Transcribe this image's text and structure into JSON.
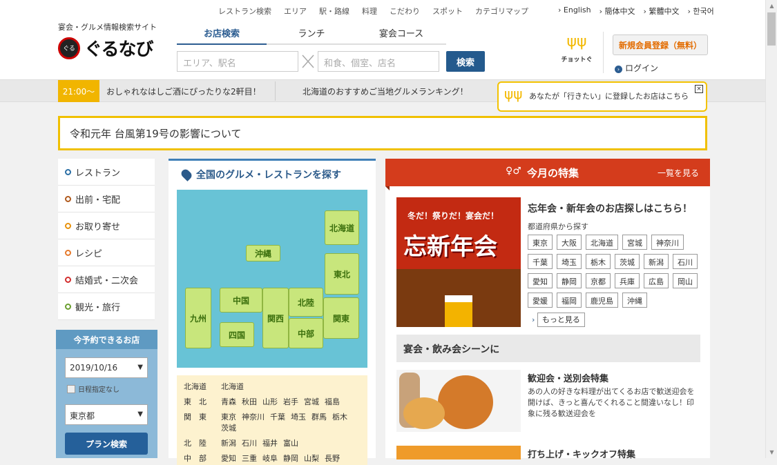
{
  "topnav": [
    "レストラン検索",
    "エリア",
    "駅・路線",
    "料理",
    "こだわり",
    "スポット",
    "カテゴリマップ"
  ],
  "languages": [
    "English",
    "簡体中文",
    "繁體中文",
    "한국어"
  ],
  "logo": {
    "tagline": "宴会・グルメ情報検索サイト",
    "name": "ぐるなび",
    "emblem": "ぐる"
  },
  "search_tabs": [
    "お店検索",
    "ランチ",
    "宴会コース"
  ],
  "search": {
    "area_placeholder": "エリア、駅名",
    "keyword_placeholder": "和食、個室、店名",
    "button": "検索"
  },
  "chotto": {
    "label": "チョットぐ",
    "icon": "fork-icon"
  },
  "register_button": "新規会員登録（無料）",
  "login": "ログイン",
  "ticker": {
    "time": "21:00〜",
    "item1": "おしゃれなはしご酒にぴったりな2軒目！",
    "item2": "北海道のおすすめご当地グルメランキング！"
  },
  "popup": {
    "text": "あなたが「行きたい」に登録したお店はこちら",
    "close": "×"
  },
  "notice": "令和元年 台風第19号の影響について",
  "left_menu": [
    {
      "label": "レストラン",
      "color": "#2b6fa5"
    },
    {
      "label": "出前・宅配",
      "color": "#b05a1d"
    },
    {
      "label": "お取り寄せ",
      "color": "#e8920c"
    },
    {
      "label": "レシピ",
      "color": "#e67a2c"
    },
    {
      "label": "結婚式・二次会",
      "color": "#d22d2d"
    },
    {
      "label": "観光・旅行",
      "color": "#6a9e2e"
    }
  ],
  "reservation": {
    "title": "今予約できるお店",
    "date": "2019/10/16",
    "no_date": "日程指定なし",
    "prefecture": "東京都",
    "button": "プラン検索"
  },
  "map_section": {
    "title": "全国のグルメ・レストランを探す",
    "regions": [
      "北海道",
      "沖縄",
      "東北",
      "中国",
      "北陸",
      "九州",
      "関西",
      "関東",
      "四国",
      "中部"
    ],
    "list": [
      {
        "region": "北海道",
        "prefs": [
          "北海道"
        ]
      },
      {
        "region": "東　北",
        "prefs": [
          "青森",
          "秋田",
          "山形",
          "岩手",
          "宮城",
          "福島"
        ]
      },
      {
        "region": "関　東",
        "prefs": [
          "東京",
          "神奈川",
          "千葉",
          "埼玉",
          "群馬",
          "栃木",
          "茨城"
        ]
      },
      {
        "region": "北　陸",
        "prefs": [
          "新潟",
          "石川",
          "福井",
          "富山"
        ]
      },
      {
        "region": "中　部",
        "prefs": [
          "愛知",
          "三重",
          "岐阜",
          "静岡",
          "山梨",
          "長野"
        ]
      }
    ]
  },
  "feature": {
    "title": "今月の特集",
    "more": "一覧を見る",
    "banner_top": "冬だ！祭りだ！宴会だ！",
    "banner_big": "忘新年会",
    "heading": "忘年会・新年会のお店探しはこちら！",
    "sub": "都道府県から探す",
    "prefs": [
      "東京",
      "大阪",
      "北海道",
      "宮城",
      "神奈川",
      "千葉",
      "埼玉",
      "栃木",
      "茨城",
      "新潟",
      "石川",
      "愛知",
      "静岡",
      "京都",
      "兵庫",
      "広島",
      "岡山",
      "愛媛",
      "福岡",
      "鹿児島",
      "沖縄"
    ],
    "more_link": "もっと見る",
    "scene": "宴会・飲み会シーンに",
    "item1_title": "歓迎会・送別会特集",
    "item1_text": "あの人の好きな料理が出てくるお店で歓送迎会を開けば、きっと喜んでくれること間違いなし！印象に残る歓送迎会を",
    "item2_title": "打ち上げ・キックオフ特集"
  }
}
